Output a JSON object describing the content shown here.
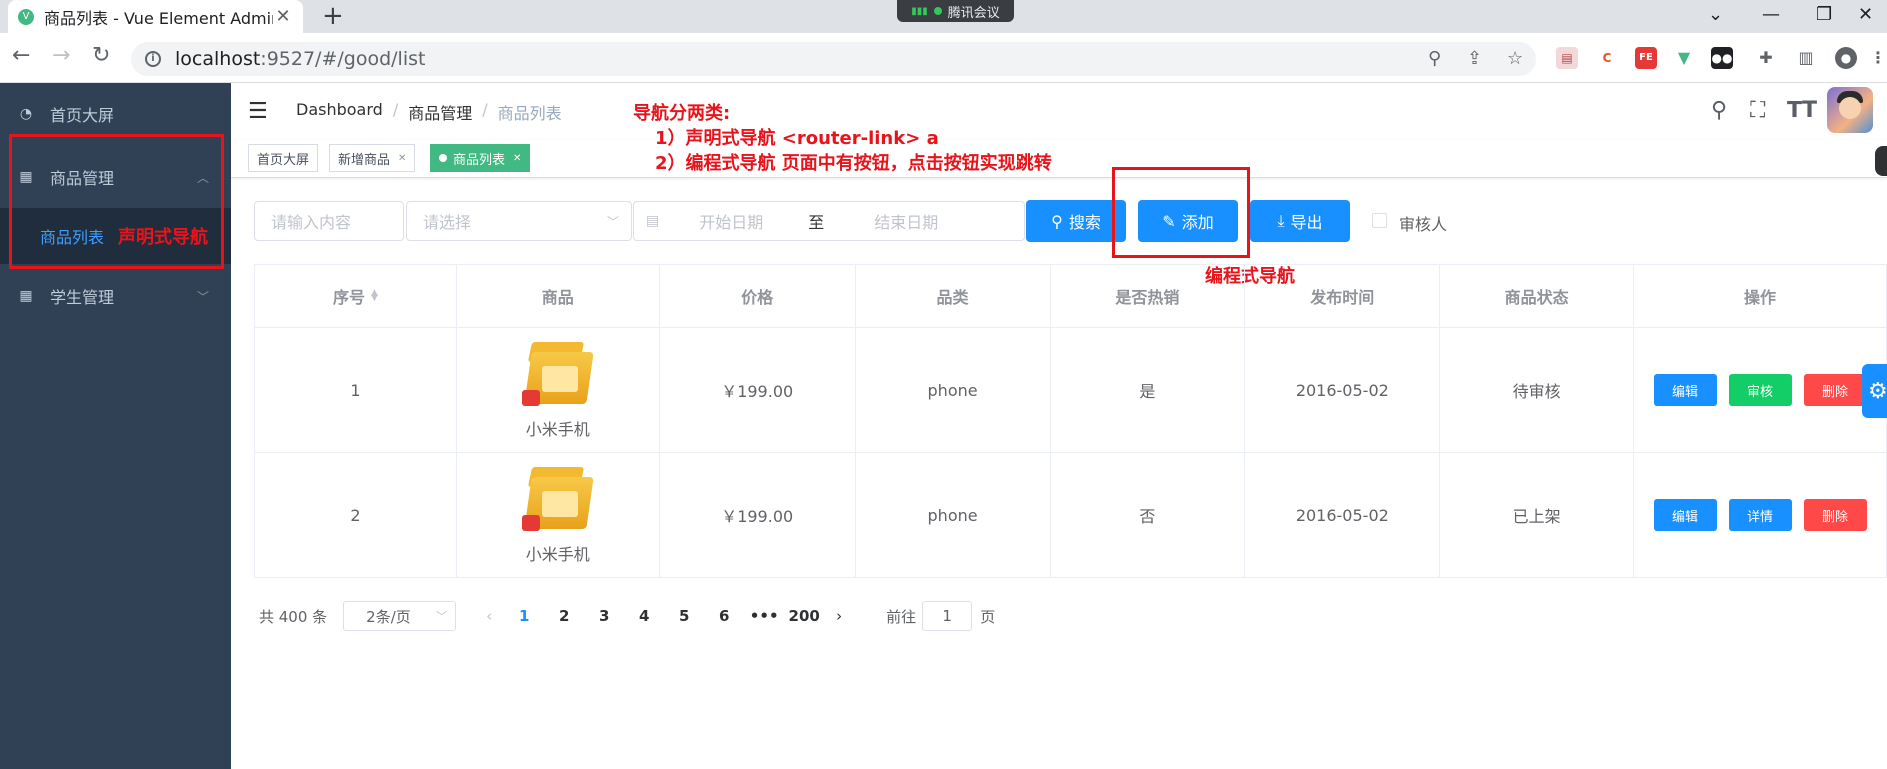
{
  "browser": {
    "tab_title": "商品列表 - Vue Element Admin",
    "tab_close": "✕",
    "new_tab": "+",
    "meeting_label": "腾讯会议",
    "url_host": "localhost",
    "url_rest": ":9527/#/good/list",
    "win_min": "⌄",
    "win_dash": "—",
    "win_restore": "❐",
    "win_close": "✕"
  },
  "sidebar": {
    "items": [
      {
        "label": "首页大屏",
        "icon": "dashboard-icon"
      },
      {
        "label": "商品管理",
        "icon": "grid-icon"
      },
      {
        "label": "学生管理",
        "icon": "grid-icon"
      }
    ],
    "sub_item": {
      "label": "商品列表"
    },
    "annotation": "声明式导航"
  },
  "navbar": {
    "breadcrumb": [
      "Dashboard",
      "商品管理",
      "商品列表"
    ],
    "separator": "/"
  },
  "annotations": {
    "title": "导航分两类:",
    "line1": "1）声明式导航  <router-link>   a",
    "line2": "2）编程式导航   页面中有按钮，点击按钮实现跳转",
    "programmatic": "编程式导航"
  },
  "tags": [
    {
      "label": "首页大屏",
      "active": false,
      "closable": false
    },
    {
      "label": "新增商品",
      "active": false,
      "closable": true
    },
    {
      "label": "商品列表",
      "active": true,
      "closable": true
    }
  ],
  "filters": {
    "keyword_placeholder": "请输入内容",
    "select_placeholder": "请选择",
    "start_placeholder": "开始日期",
    "range_sep": "至",
    "end_placeholder": "结束日期",
    "search_label": "搜索",
    "add_label": "添加",
    "export_label": "导出",
    "reviewer_label": "审核人"
  },
  "table": {
    "columns": [
      "序号",
      "商品",
      "价格",
      "品类",
      "是否热销",
      "发布时间",
      "商品状态",
      "操作"
    ],
    "rows": [
      {
        "index": "1",
        "name": "小米手机",
        "price": "￥199.00",
        "category": "phone",
        "hot": "是",
        "date": "2016-05-02",
        "status": "待审核",
        "actions": [
          "编辑",
          "审核",
          "删除"
        ]
      },
      {
        "index": "2",
        "name": "小米手机",
        "price": "￥199.00",
        "category": "phone",
        "hot": "否",
        "date": "2016-05-02",
        "status": "已上架",
        "actions": [
          "编辑",
          "详情",
          "删除"
        ]
      }
    ]
  },
  "pagination": {
    "total": "共 400 条",
    "page_size": "2条/页",
    "pages": [
      "1",
      "2",
      "3",
      "4",
      "5",
      "6",
      "•••",
      "200"
    ],
    "current": "1",
    "goto_prefix": "前往",
    "goto_value": "1",
    "goto_suffix": "页"
  },
  "colors": {
    "primary": "#1890ff",
    "sidebar_bg": "#304156",
    "annotation": "#e8141b",
    "tag_active": "#42b983"
  }
}
